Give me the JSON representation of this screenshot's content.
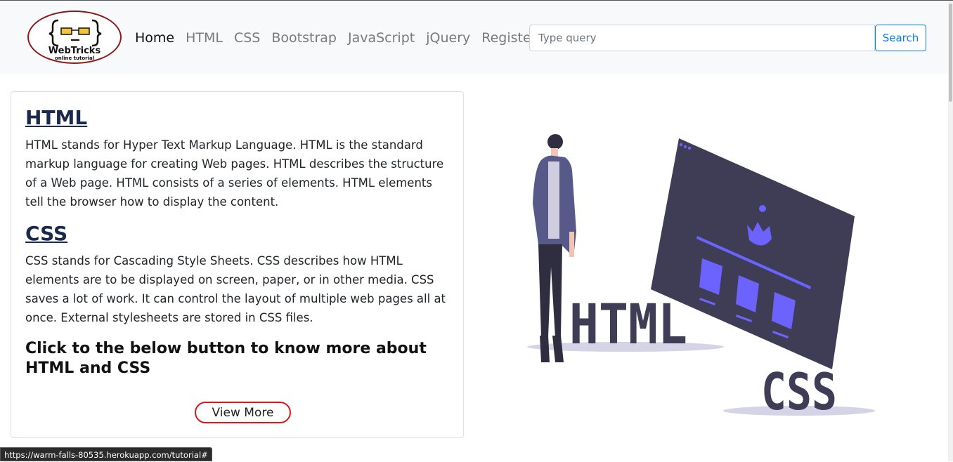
{
  "logo": {
    "name": "WebTricks",
    "tagline": "online tutorial"
  },
  "nav": {
    "links": [
      "Home",
      "HTML",
      "CSS",
      "Bootstrap",
      "JavaScript",
      "jQuery",
      "Register"
    ],
    "active": "Home"
  },
  "search": {
    "placeholder": "Type query",
    "value": "",
    "button_label": "Search"
  },
  "card": {
    "html_title": "HTML",
    "html_text": "HTML stands for Hyper Text Markup Language. HTML is the standard markup language for creating Web pages. HTML describes the structure of a Web page. HTML consists of a series of elements. HTML elements tell the browser how to display the content.",
    "css_title": "CSS",
    "css_text": "CSS stands for Cascading Style Sheets. CSS describes how HTML elements are to be displayed on screen, paper, or in other media. CSS saves a lot of work. It can control the layout of multiple web pages all at once. External stylesheets are stored in CSS files.",
    "cta_heading": "Click to the below button to know more about HTML and CSS",
    "button_label": "View More"
  },
  "illustration": {
    "html_label": "HTML",
    "css_label": "CSS"
  },
  "status_url": "https://warm-falls-80535.herokuapp.com/tutorial#",
  "colors": {
    "accent": "#6c63ff",
    "dark": "#3f3d56",
    "link": "#007bff",
    "button_border": "#d41c1c"
  }
}
